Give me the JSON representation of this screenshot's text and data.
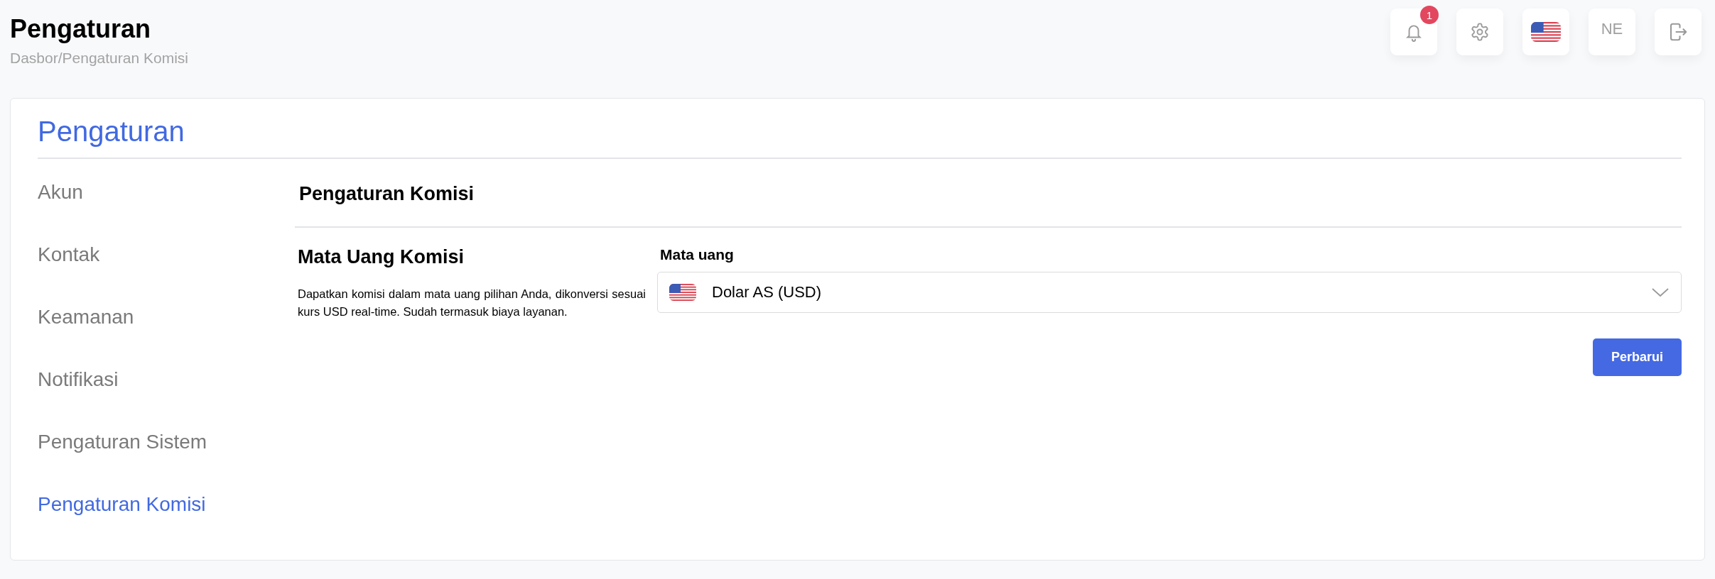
{
  "header": {
    "title": "Pengaturan",
    "breadcrumb": "Dasbor/Pengaturan Komisi",
    "notification_count": "1",
    "user_initials": "NE"
  },
  "card": {
    "title": "Pengaturan",
    "menu": [
      {
        "label": "Akun",
        "selected": false
      },
      {
        "label": "Kontak",
        "selected": false
      },
      {
        "label": "Keamanan",
        "selected": false
      },
      {
        "label": "Notifikasi",
        "selected": false
      },
      {
        "label": "Pengaturan Sistem",
        "selected": false
      },
      {
        "label": "Pengaturan Komisi",
        "selected": true
      }
    ],
    "section_title": "Pengaturan Komisi",
    "currency_title": "Mata Uang Komisi",
    "currency_description": "Dapatkan komisi dalam mata uang pilihan Anda, dikonversi sesuai kurs USD real-time. Sudah termasuk biaya layanan.",
    "field_label": "Mata uang",
    "field_value": "Dolar AS (USD)",
    "button": "Perbarui"
  }
}
